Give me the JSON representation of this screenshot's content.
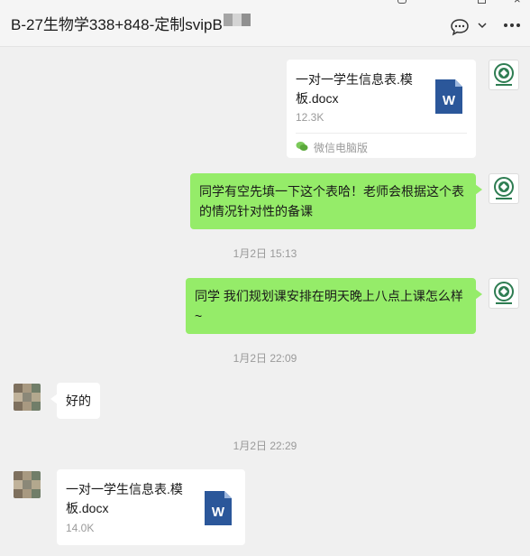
{
  "header": {
    "title": "B-27生物学338+848-定制svipB",
    "chat_icon": "chat-bubble-icon",
    "chevron_icon": "chevron-down-icon",
    "more_icon": "more-icon"
  },
  "colors": {
    "self_bubble": "#95ec69",
    "other_bubble": "#ffffff",
    "background": "#f0f0f0",
    "word_blue": "#2b579a"
  },
  "messages": [
    {
      "sender": "self",
      "type": "file",
      "file_name": "一对一学生信息表.模板.docx",
      "file_size": "12.3K",
      "source": "微信电脑版"
    },
    {
      "sender": "self",
      "type": "text",
      "text": "同学有空先填一下这个表哈！老师会根据这个表的情况针对性的备课"
    },
    {
      "type": "timestamp",
      "text": "1月2日 15:13"
    },
    {
      "sender": "self",
      "type": "text",
      "text": "同学 我们规划课安排在明天晚上八点上课怎么样~"
    },
    {
      "type": "timestamp",
      "text": "1月2日 22:09"
    },
    {
      "sender": "other",
      "type": "text",
      "text": "好的"
    },
    {
      "type": "timestamp",
      "text": "1月2日 22:29"
    },
    {
      "sender": "other",
      "type": "file",
      "file_name": "一对一学生信息表.模板.docx",
      "file_size": "14.0K"
    }
  ]
}
